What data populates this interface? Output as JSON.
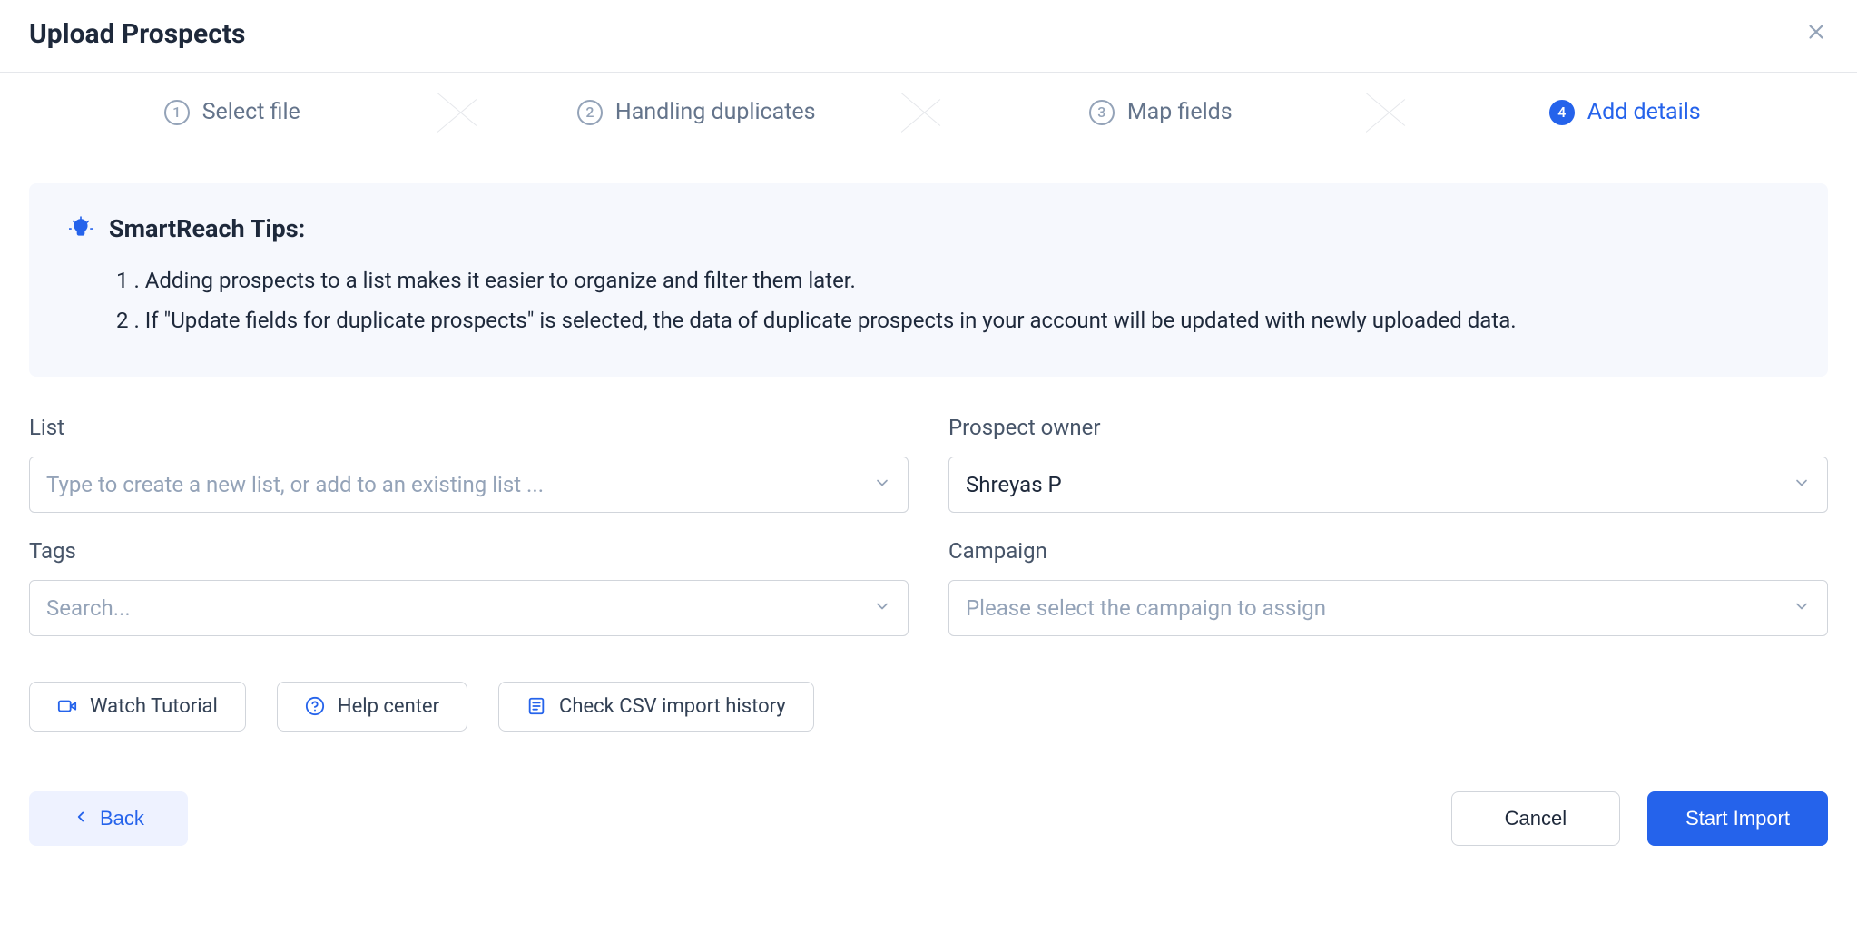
{
  "header": {
    "title": "Upload Prospects"
  },
  "steps": [
    {
      "num": "1",
      "label": "Select file",
      "active": false
    },
    {
      "num": "2",
      "label": "Handling duplicates",
      "active": false
    },
    {
      "num": "3",
      "label": "Map fields",
      "active": false
    },
    {
      "num": "4",
      "label": "Add details",
      "active": true
    }
  ],
  "tips": {
    "heading": "SmartReach Tips:",
    "items": [
      "1 . Adding prospects to a list makes it easier to organize and filter them later.",
      "2 . If \"Update fields for duplicate prospects\" is selected, the data of duplicate prospects in your account will be updated with newly uploaded data."
    ]
  },
  "form": {
    "list": {
      "label": "List",
      "placeholder": "Type to create a new list, or add to an existing list ..."
    },
    "owner": {
      "label": "Prospect owner",
      "value": "Shreyas P"
    },
    "tags": {
      "label": "Tags",
      "placeholder": "Search..."
    },
    "campaign": {
      "label": "Campaign",
      "placeholder": "Please select the campaign to assign"
    }
  },
  "helpers": {
    "watch": "Watch Tutorial",
    "help": "Help center",
    "history": "Check CSV import history"
  },
  "footer": {
    "back": "Back",
    "cancel": "Cancel",
    "start": "Start Import"
  }
}
